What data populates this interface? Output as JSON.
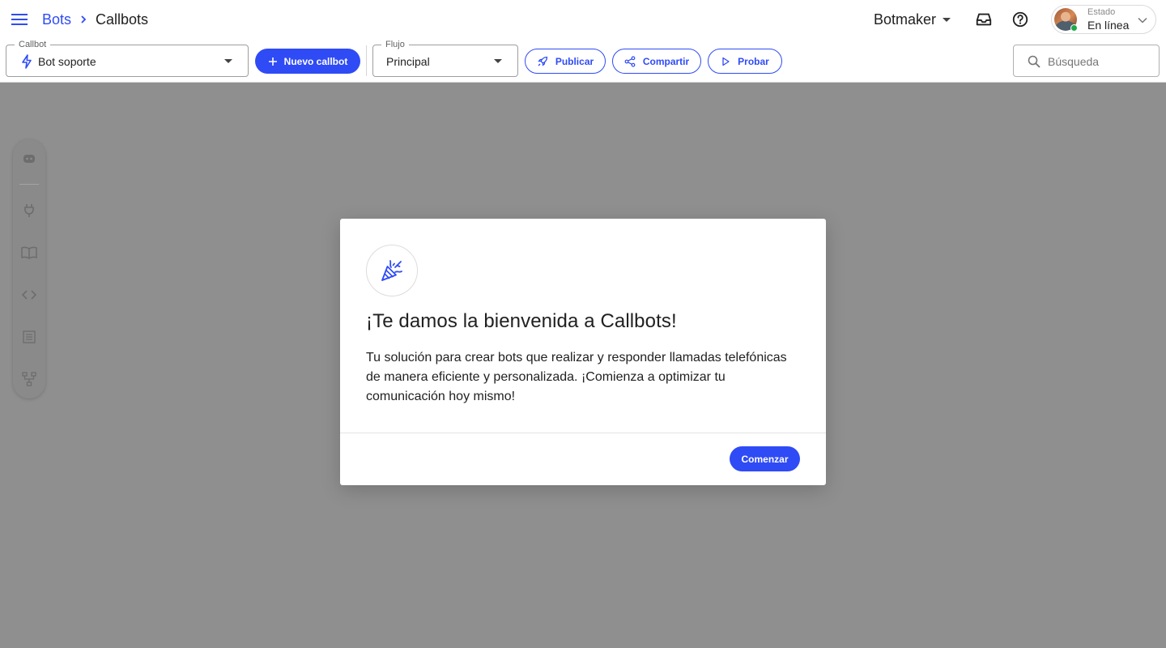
{
  "header": {
    "breadcrumb": {
      "root": "Bots",
      "current": "Callbots"
    },
    "workspace": "Botmaker",
    "status": {
      "label": "Estado",
      "value": "En línea"
    }
  },
  "toolbar": {
    "callbot_select": {
      "legend": "Callbot",
      "value": "Bot soporte"
    },
    "new_callbot_label": "Nuevo callbot",
    "flow_select": {
      "legend": "Flujo",
      "value": "Principal"
    },
    "publish_label": "Publicar",
    "share_label": "Compartir",
    "test_label": "Probar",
    "search_placeholder": "Búsqueda"
  },
  "side_rail": {
    "items": [
      "robot-icon",
      "plug-icon",
      "book-icon",
      "code-icon",
      "list-icon",
      "flow-icon"
    ]
  },
  "dialog": {
    "icon": "party-popper-icon",
    "title": "¡Te damos la bienvenida a Callbots!",
    "body": "Tu solución para crear bots que realizar y responder llamadas telefónicas de manera eficiente y personalizada. ¡Comienza a optimizar tu comunicación hoy mismo!",
    "cta_label": "Comenzar"
  },
  "colors": {
    "accent": "#2f4bf5",
    "overlay": "#8f8f8f",
    "online": "#1ea94a"
  }
}
